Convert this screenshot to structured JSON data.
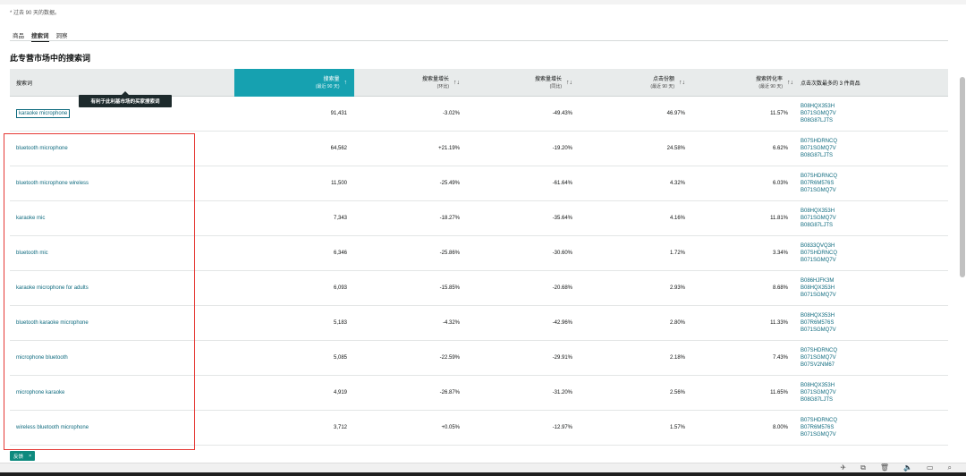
{
  "note": "* 过去 90 天的数据。",
  "tabs": [
    {
      "label": "商品"
    },
    {
      "label": "搜索词"
    },
    {
      "label": "洞察"
    }
  ],
  "section_title": "此专营市场中的搜索词",
  "columns": {
    "keyword": "搜索词",
    "volume": {
      "label": "搜索量",
      "sub": "(最近 90 天)",
      "sort": "↑"
    },
    "growth_qoq": {
      "label": "搜索量增长",
      "sub": "(环比)",
      "sort": "↑↓"
    },
    "growth_yoy": {
      "label": "搜索量增长",
      "sub": "(同比)",
      "sort": "↑↓"
    },
    "click_share": {
      "label": "点击份额",
      "sub": "(最近 90 天)",
      "sort": "↑↓"
    },
    "conversion": {
      "label": "搜索转化率",
      "sub": "(最近 90 天)",
      "sort": "↑↓"
    },
    "top_asins": "点击次数最多的 3 件商品"
  },
  "tooltip": "有利于此利基市场的买家搜索词",
  "rows": [
    {
      "keyword": "karaoke microphone",
      "volume": "91,431",
      "qoq": "-3.02%",
      "yoy": "-49.43%",
      "click": "46.97%",
      "conv": "11.57%",
      "asins": [
        "B08HQX353H",
        "B071SGMQ7V",
        "B08G87LJTS"
      ]
    },
    {
      "keyword": "bluetooth microphone",
      "volume": "64,562",
      "qoq": "+21.19%",
      "yoy": "-19.20%",
      "click": "24.58%",
      "conv": "6.62%",
      "asins": [
        "B07SHDRNCQ",
        "B071SGMQ7V",
        "B08G87LJTS"
      ]
    },
    {
      "keyword": "bluetooth microphone wireless",
      "volume": "11,500",
      "qoq": "-25.49%",
      "yoy": "-61.64%",
      "click": "4.32%",
      "conv": "6.03%",
      "asins": [
        "B07SHDRNCQ",
        "B07R6M576S",
        "B071SGMQ7V"
      ]
    },
    {
      "keyword": "karaoke mic",
      "volume": "7,343",
      "qoq": "-18.27%",
      "yoy": "-35.64%",
      "click": "4.16%",
      "conv": "11.81%",
      "asins": [
        "B08HQX353H",
        "B071SGMQ7V",
        "B08G87LJTS"
      ]
    },
    {
      "keyword": "bluetooth mic",
      "volume": "6,346",
      "qoq": "-25.86%",
      "yoy": "-30.60%",
      "click": "1.72%",
      "conv": "3.34%",
      "asins": [
        "B0833QVQ3H",
        "B07SHDRNCQ",
        "B071SGMQ7V"
      ]
    },
    {
      "keyword": "karaoke microphone for adults",
      "volume": "6,093",
      "qoq": "-15.85%",
      "yoy": "-20.68%",
      "click": "2.93%",
      "conv": "8.68%",
      "asins": [
        "B086HJFK3M",
        "B08HQX353H",
        "B071SGMQ7V"
      ]
    },
    {
      "keyword": "bluetooth karaoke microphone",
      "volume": "5,183",
      "qoq": "-4.32%",
      "yoy": "-42.96%",
      "click": "2.80%",
      "conv": "11.33%",
      "asins": [
        "B08HQX353H",
        "B07R6M576S",
        "B071SGMQ7V"
      ]
    },
    {
      "keyword": "microphone bluetooth",
      "volume": "5,085",
      "qoq": "-22.59%",
      "yoy": "-29.91%",
      "click": "2.18%",
      "conv": "7.43%",
      "asins": [
        "B07SHDRNCQ",
        "B071SGMQ7V",
        "B07SV2NM67"
      ]
    },
    {
      "keyword": "microphone karaoke",
      "volume": "4,919",
      "qoq": "-26.87%",
      "yoy": "-31.20%",
      "click": "2.56%",
      "conv": "11.65%",
      "asins": [
        "B08HQX353H",
        "B071SGMQ7V",
        "B08G87LJTS"
      ]
    },
    {
      "keyword": "wireless bluetooth microphone",
      "volume": "3,712",
      "qoq": "+0.05%",
      "yoy": "-12.97%",
      "click": "1.57%",
      "conv": "8.00%",
      "asins": [
        "B07SHDRNCQ",
        "B07R6M576S",
        "B071SGMQ7V"
      ]
    }
  ],
  "feedback": {
    "label": "反馈",
    "close": "×"
  },
  "bottom_icons": [
    "pin-icon",
    "copy-icon",
    "trash-icon",
    "speaker-icon",
    "window-icon",
    "search-icon"
  ]
}
